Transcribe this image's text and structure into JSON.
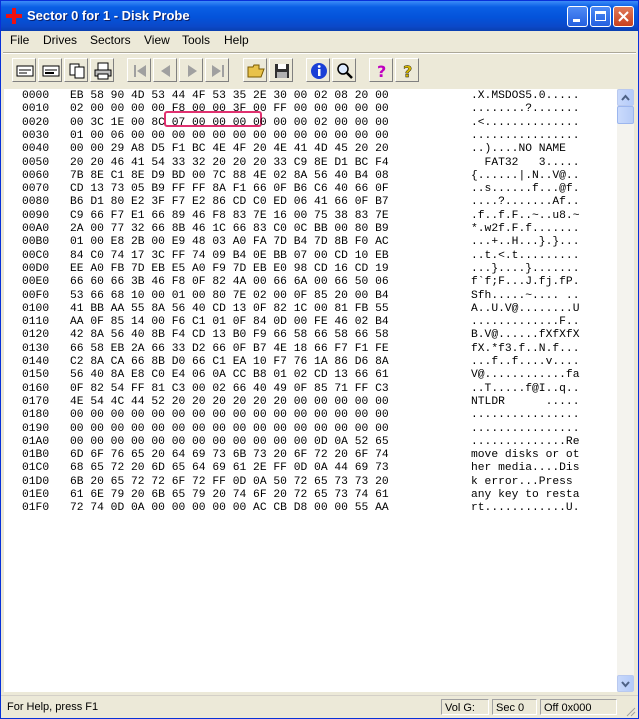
{
  "window": {
    "title": "Sector 0 for 1 - Disk Probe"
  },
  "menu": [
    "File",
    "Drives",
    "Sectors",
    "View",
    "Tools",
    "Help"
  ],
  "toolbar": {
    "buttons": [
      "read-sector-icon",
      "write-sector-icon",
      "copy-icon",
      "print-icon",
      "first-sector-icon",
      "previous-sector-icon",
      "next-sector-icon",
      "last-sector-icon",
      "open-folder-icon",
      "save-icon",
      "info-icon",
      "find-icon",
      "help-icon",
      "context-help-icon"
    ]
  },
  "hex_rows": [
    {
      "addr": "0000",
      "bytes": "EB 58 90 4D 53 44 4F 53 35 2E 30 00 02 08 20 00",
      "ascii": ".X.MSDOS5.0....."
    },
    {
      "addr": "0010",
      "bytes": "02 00 00 00 00 F8 00 00 3F 00 FF 00 00 00 00 00",
      "ascii": "........?......."
    },
    {
      "addr": "0020",
      "bytes": "00 3C 1E 00 8C 07 00 00 00 00 00 00 02 00 00 00",
      "ascii": ".<.............."
    },
    {
      "addr": "0030",
      "bytes": "01 00 06 00 00 00 00 00 00 00 00 00 00 00 00 00",
      "ascii": "................"
    },
    {
      "addr": "0040",
      "bytes": "00 00 29 A8 D5 F1 BC 4E 4F 20 4E 41 4D 45 20 20",
      "ascii": "..)....NO NAME  "
    },
    {
      "addr": "0050",
      "bytes": "20 20 46 41 54 33 32 20 20 20 33 C9 8E D1 BC F4",
      "ascii": "  FAT32   3....."
    },
    {
      "addr": "0060",
      "bytes": "7B 8E C1 8E D9 BD 00 7C 88 4E 02 8A 56 40 B4 08",
      "ascii": "{......|.N..V@.."
    },
    {
      "addr": "0070",
      "bytes": "CD 13 73 05 B9 FF FF 8A F1 66 0F B6 C6 40 66 0F",
      "ascii": "..s......f...@f."
    },
    {
      "addr": "0080",
      "bytes": "B6 D1 80 E2 3F F7 E2 86 CD C0 ED 06 41 66 0F B7",
      "ascii": "....?.......Af.."
    },
    {
      "addr": "0090",
      "bytes": "C9 66 F7 E1 66 89 46 F8 83 7E 16 00 75 38 83 7E",
      "ascii": ".f..f.F..~..u8.~"
    },
    {
      "addr": "00A0",
      "bytes": "2A 00 77 32 66 8B 46 1C 66 83 C0 0C BB 00 80 B9",
      "ascii": "*.w2f.F.f......."
    },
    {
      "addr": "00B0",
      "bytes": "01 00 E8 2B 00 E9 48 03 A0 FA 7D B4 7D 8B F0 AC",
      "ascii": "...+..H...}.}..."
    },
    {
      "addr": "00C0",
      "bytes": "84 C0 74 17 3C FF 74 09 B4 0E BB 07 00 CD 10 EB",
      "ascii": "..t.<.t........."
    },
    {
      "addr": "00D0",
      "bytes": "EE A0 FB 7D EB E5 A0 F9 7D EB E0 98 CD 16 CD 19",
      "ascii": "...}....}......."
    },
    {
      "addr": "00E0",
      "bytes": "66 60 66 3B 46 F8 0F 82 4A 00 66 6A 00 66 50 06",
      "ascii": "f`f;F...J.fj.fP."
    },
    {
      "addr": "00F0",
      "bytes": "53 66 68 10 00 01 00 80 7E 02 00 0F 85 20 00 B4",
      "ascii": "Sfh.....~.... .."
    },
    {
      "addr": "0100",
      "bytes": "41 BB AA 55 8A 56 40 CD 13 0F 82 1C 00 81 FB 55",
      "ascii": "A..U.V@........U"
    },
    {
      "addr": "0110",
      "bytes": "AA 0F 85 14 00 F6 C1 01 0F 84 0D 00 FE 46 02 B4",
      "ascii": ".............F.."
    },
    {
      "addr": "0120",
      "bytes": "42 8A 56 40 8B F4 CD 13 B0 F9 66 58 66 58 66 58",
      "ascii": "B.V@......fXfXfX"
    },
    {
      "addr": "0130",
      "bytes": "66 58 EB 2A 66 33 D2 66 0F B7 4E 18 66 F7 F1 FE",
      "ascii": "fX.*f3.f..N.f..."
    },
    {
      "addr": "0140",
      "bytes": "C2 8A CA 66 8B D0 66 C1 EA 10 F7 76 1A 86 D6 8A",
      "ascii": "...f..f....v...."
    },
    {
      "addr": "0150",
      "bytes": "56 40 8A E8 C0 E4 06 0A CC B8 01 02 CD 13 66 61",
      "ascii": "V@............fa"
    },
    {
      "addr": "0160",
      "bytes": "0F 82 54 FF 81 C3 00 02 66 40 49 0F 85 71 FF C3",
      "ascii": "..T.....f@I..q.."
    },
    {
      "addr": "0170",
      "bytes": "4E 54 4C 44 52 20 20 20 20 20 20 00 00 00 00 00",
      "ascii": "NTLDR      ....."
    },
    {
      "addr": "0180",
      "bytes": "00 00 00 00 00 00 00 00 00 00 00 00 00 00 00 00",
      "ascii": "................"
    },
    {
      "addr": "0190",
      "bytes": "00 00 00 00 00 00 00 00 00 00 00 00 00 00 00 00",
      "ascii": "................"
    },
    {
      "addr": "01A0",
      "bytes": "00 00 00 00 00 00 00 00 00 00 00 00 0D 0A 52 65",
      "ascii": "..............Re"
    },
    {
      "addr": "01B0",
      "bytes": "6D 6F 76 65 20 64 69 73 6B 73 20 6F 72 20 6F 74",
      "ascii": "move disks or ot"
    },
    {
      "addr": "01C0",
      "bytes": "68 65 72 20 6D 65 64 69 61 2E FF 0D 0A 44 69 73",
      "ascii": "her media....Dis"
    },
    {
      "addr": "01D0",
      "bytes": "6B 20 65 72 72 6F 72 FF 0D 0A 50 72 65 73 73 20",
      "ascii": "k error...Press "
    },
    {
      "addr": "01E0",
      "bytes": "61 6E 79 20 6B 65 79 20 74 6F 20 72 65 73 74 61",
      "ascii": "any key to resta"
    },
    {
      "addr": "01F0",
      "bytes": "72 74 0D 0A 00 00 00 00 00 AC CB D8 00 00 55 AA",
      "ascii": "rt............U."
    }
  ],
  "status": {
    "help": "For Help, press F1",
    "volume": "Vol  G:",
    "sector": "Sec 0",
    "offset": "Off 0x000"
  },
  "colors": {
    "titlebar": "#0453DA",
    "highlight": "#E0306F",
    "background": "#ECE9D8"
  }
}
